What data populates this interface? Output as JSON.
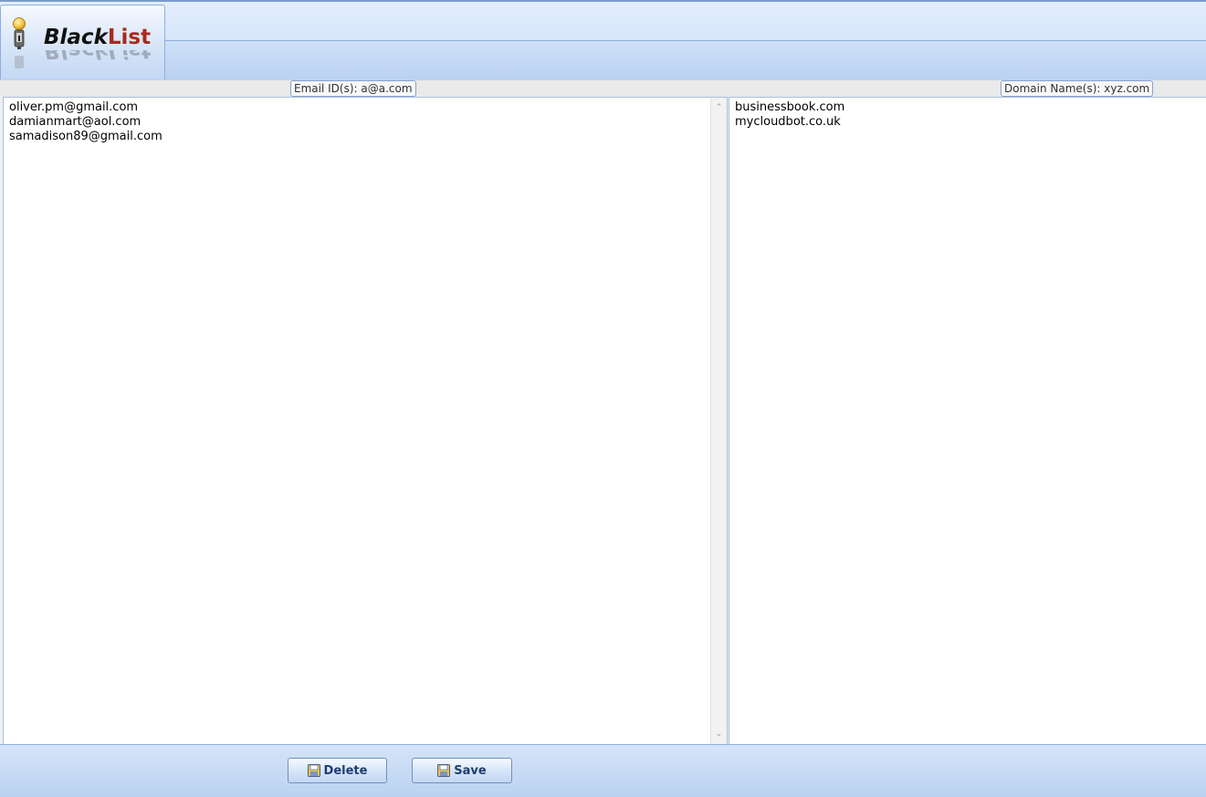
{
  "app": {
    "title_part1": "Black",
    "title_part2": "List",
    "title_reflection": "BlackList",
    "logo_icon": "lightbulb-icon"
  },
  "email_panel": {
    "label": "Email ID(s): a@a.com",
    "content": "oliver.pm@gmail.com\ndamianmart@aol.com\nsamadison89@gmail.com"
  },
  "domain_panel": {
    "label": "Domain Name(s): xyz.com",
    "content": "businessbook.com\nmycloudbot.co.uk"
  },
  "toolbar": {
    "delete_label": "Delete",
    "save_label": "Save",
    "button_icon": "floppy-disk-icon"
  },
  "colors": {
    "accent": "#a8291d",
    "header_bg": "#c8dcf6",
    "border": "#8eaee0"
  }
}
